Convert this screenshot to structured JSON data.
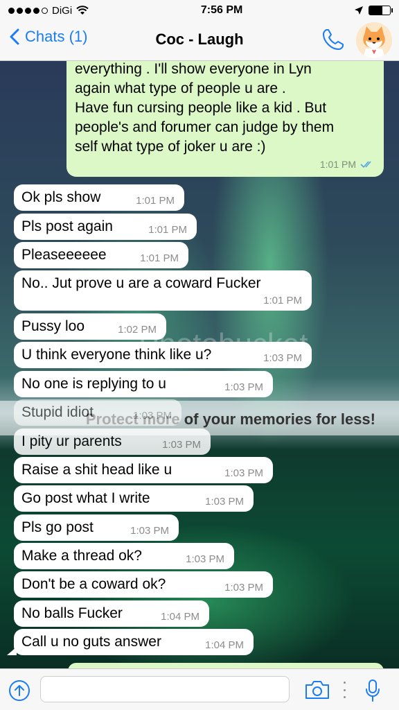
{
  "status_bar": {
    "carrier": "DiGi",
    "time": "7:56 PM",
    "signal_bars": 4,
    "signal_total": 5,
    "battery_level": 0.65
  },
  "nav": {
    "back_label": "Chats (1)",
    "title": "Coc - Laugh",
    "accent": "#1a7cf5"
  },
  "outgoing_message": {
    "lines": [
      "everything . I'll show everyone in Lyn",
      "again what type of people u are .",
      "",
      "Have fun cursing people like a kid . But",
      "people's and forumer can judge by them",
      "self what type of joker u are :)"
    ],
    "time": "1:01 PM",
    "read": true,
    "bubble_color": "#dcf8c6"
  },
  "incoming_messages": [
    {
      "text": "Ok pls show",
      "time": "1:01 PM"
    },
    {
      "text": "Pls post again",
      "time": "1:01 PM"
    },
    {
      "text": "Pleaseeeeee",
      "time": "1:01 PM"
    },
    {
      "text": "No.. Jut prove u are a coward Fucker",
      "time": "1:01 PM"
    },
    {
      "text": "Pussy loo",
      "time": "1:02 PM"
    },
    {
      "text": "U think everyone think like u?",
      "time": "1:03 PM"
    },
    {
      "text": "No one is replying to u",
      "time": "1:03 PM"
    },
    {
      "text": "Stupid idiot",
      "time": "1:03 PM"
    },
    {
      "text": "I pity ur parents",
      "time": "1:03 PM"
    },
    {
      "text": "Raise a shit head like u",
      "time": "1:03 PM"
    },
    {
      "text": "Go post what I write",
      "time": "1:03 PM"
    },
    {
      "text": "Pls go post",
      "time": "1:03 PM"
    },
    {
      "text": "Make a thread ok?",
      "time": "1:03 PM"
    },
    {
      "text": "Don't be a coward ok?",
      "time": "1:03 PM"
    },
    {
      "text": "No balls Fucker",
      "time": "1:04 PM"
    },
    {
      "text": "Call u no guts answer",
      "time": "1:04 PM"
    }
  ],
  "watermark": {
    "brand": "Photobucket",
    "tagline": "Protect more of your memories for less!"
  },
  "input_bar": {
    "placeholder": ""
  },
  "icons": [
    "back-chevron-icon",
    "phone-icon",
    "avatar",
    "upload-icon",
    "camera-icon",
    "more-icon",
    "microphone-icon",
    "read-ticks-icon"
  ]
}
